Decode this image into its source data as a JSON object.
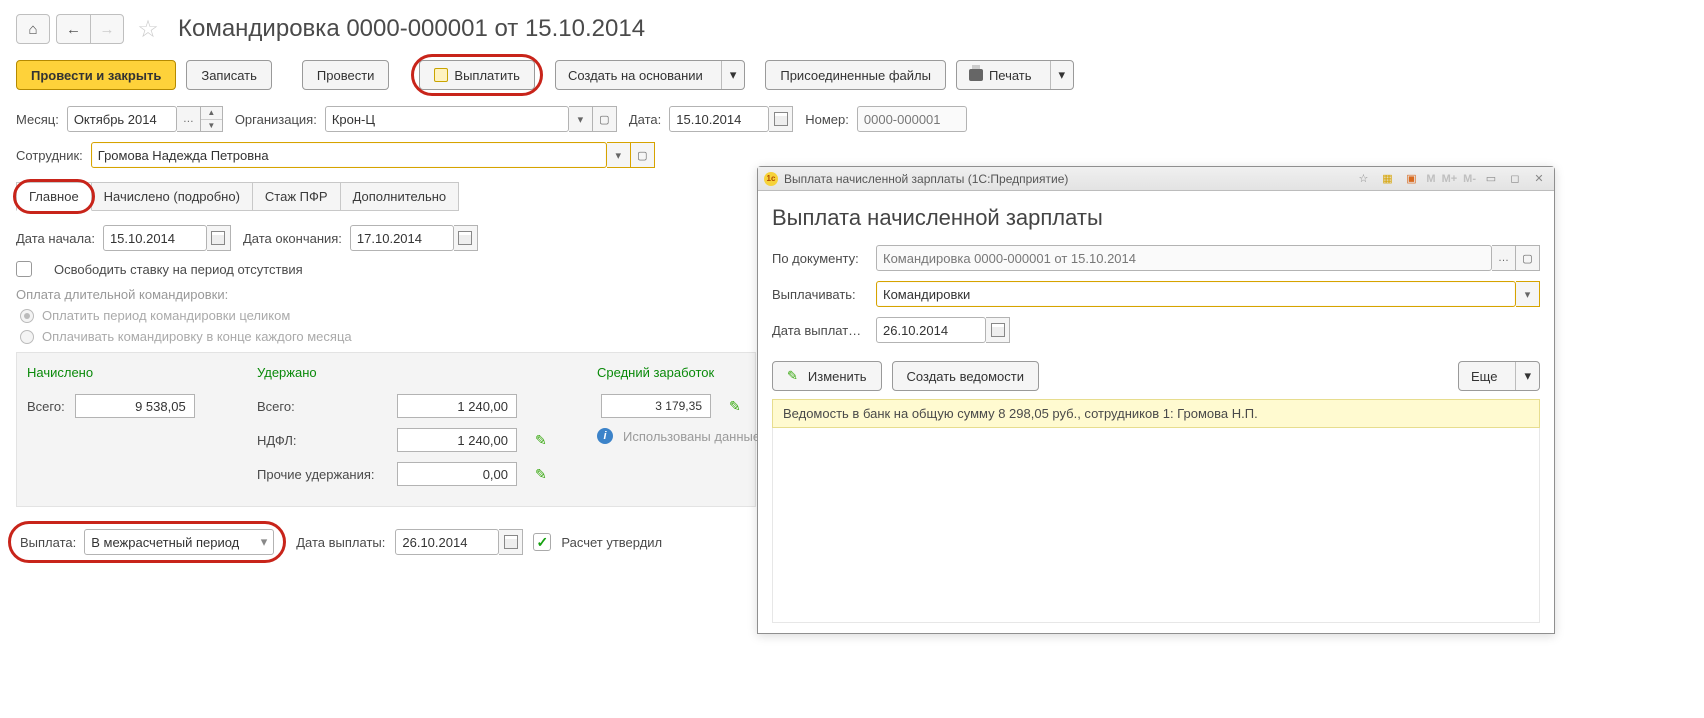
{
  "header": {
    "title": "Командировка 0000-000001 от 15.10.2014"
  },
  "toolbar": {
    "post_close": "Провести и закрыть",
    "save": "Записать",
    "post": "Провести",
    "pay": "Выплатить",
    "create_based": "Создать на основании",
    "attachments": "Присоединенные файлы",
    "print": "Печать"
  },
  "fields": {
    "month_label": "Месяц:",
    "month_value": "Октябрь 2014",
    "org_label": "Организация:",
    "org_value": "Крон-Ц",
    "date_label": "Дата:",
    "date_value": "15.10.2014",
    "number_label": "Номер:",
    "number_value": "0000-000001",
    "employee_label": "Сотрудник:",
    "employee_value": "Громова Надежда Петровна"
  },
  "tabs": {
    "main": "Главное",
    "accrued": "Начислено (подробно)",
    "pfr": "Стаж ПФР",
    "extra": "Дополнительно"
  },
  "panel": {
    "date_start_label": "Дата начала:",
    "date_start": "15.10.2014",
    "date_end_label": "Дата окончания:",
    "date_end": "17.10.2014",
    "free_rate": "Освободить ставку на период отсутствия",
    "long_trip_header": "Оплата длительной командировки:",
    "radio_full": "Оплатить период командировки целиком",
    "radio_monthly": "Оплачивать командировку в конце каждого месяца"
  },
  "totals": {
    "accrued_h": "Начислено",
    "withheld_h": "Удержано",
    "avg_h": "Средний заработок",
    "total_lbl": "Всего:",
    "accrued_total": "9 538,05",
    "withheld_total": "1 240,00",
    "ndfl_lbl": "НДФЛ:",
    "ndfl_val": "1 240,00",
    "other_lbl": "Прочие удержания:",
    "other_val": "0,00",
    "avg_val": "3 179,35",
    "avg_note": "Использованы данные о"
  },
  "footer": {
    "payout_lbl": "Выплата:",
    "payout_val": "В межрасчетный период",
    "payout_date_lbl": "Дата выплаты:",
    "payout_date": "26.10.2014",
    "approved_lbl": "Расчет утвердил"
  },
  "popup": {
    "titlebar": "Выплата начисленной зарплаты  (1С:Предприятие)",
    "heading": "Выплата начисленной зарплаты",
    "doc_lbl": "По документу:",
    "doc_val": "Командировка 0000-000001 от 15.10.2014",
    "pay_lbl": "Выплачивать:",
    "pay_val": "Командировки",
    "date_lbl": "Дата выплат…",
    "date_val": "26.10.2014",
    "edit_btn": "Изменить",
    "create_btn": "Создать ведомости",
    "more_btn": "Еще",
    "list_row": "Ведомость в банк на общую сумму 8 298,05 руб., сотрудников 1: Громова Н.П.",
    "m": "M",
    "mplus": "M+",
    "mminus": "M-"
  }
}
